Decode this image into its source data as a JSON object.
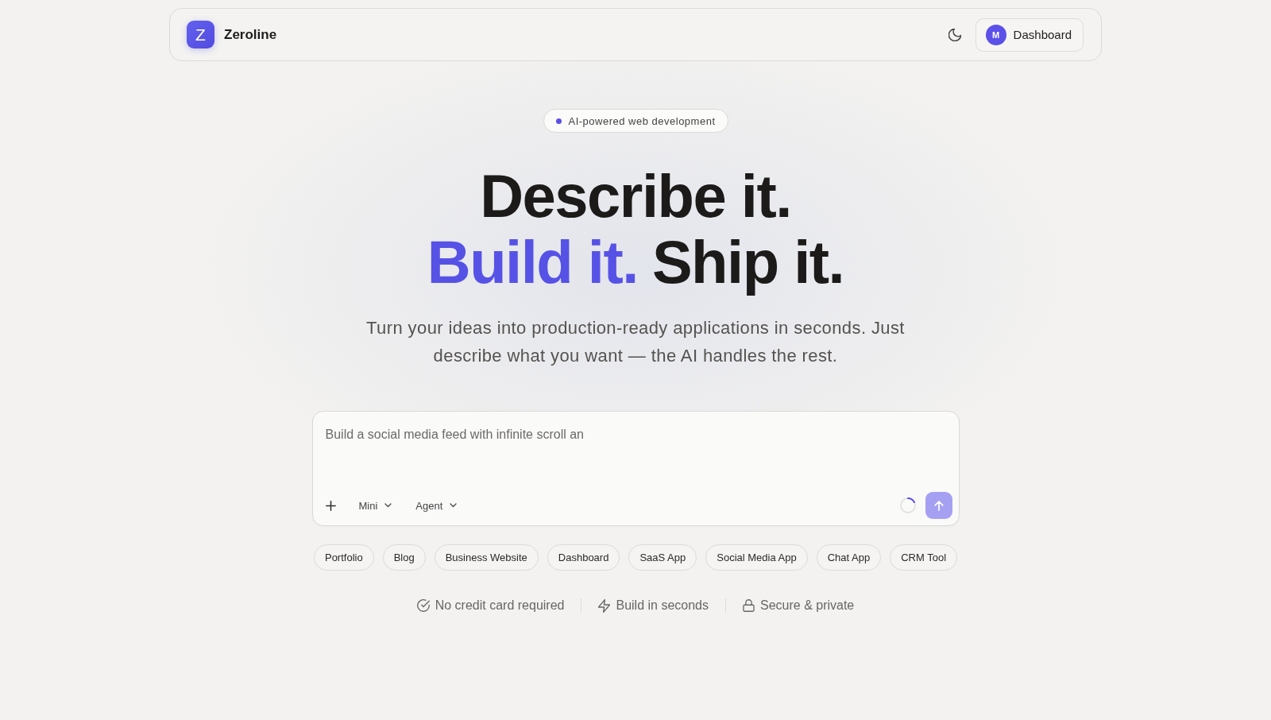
{
  "header": {
    "logo_mark": "Z",
    "brand": "Zeroline",
    "dashboard_button": {
      "avatar_initial": "M",
      "label": "Dashboard"
    }
  },
  "hero": {
    "badge": "AI-powered web development",
    "headline_lines": [
      {
        "segments": [
          {
            "text": "Describe it.",
            "highlighted": false
          }
        ]
      },
      {
        "segments": [
          {
            "text": "Build it.",
            "highlighted": true
          },
          {
            "text": "Ship it.",
            "highlighted": false
          }
        ]
      }
    ],
    "subtitle": "Turn your ideas into production-ready applications in seconds. Just describe what you want — the AI handles the rest."
  },
  "prompt": {
    "placeholder": "Build a social media feed with infinite scroll an",
    "model_dropdown": "Mini",
    "mode_dropdown": "Agent",
    "loading": true,
    "send_button": {
      "disabled": true
    }
  },
  "suggestions": [
    "Portfolio",
    "Blog",
    "Business Website",
    "Dashboard",
    "SaaS App",
    "Social Media App",
    "Chat App",
    "CRM Tool"
  ],
  "features": [
    {
      "kind": "check",
      "text": "No credit card required"
    },
    {
      "kind": "bolt",
      "text": "Build in seconds"
    },
    {
      "kind": "lock",
      "text": "Secure & private"
    }
  ]
}
